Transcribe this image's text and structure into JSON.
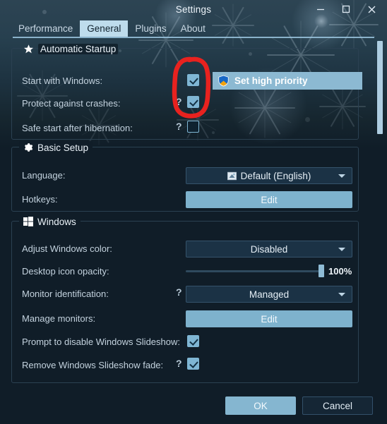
{
  "window": {
    "title": "Settings",
    "controls": [
      {
        "name": "minimize",
        "glyph": "minimize-icon"
      },
      {
        "name": "maximize",
        "glyph": "maximize-icon"
      },
      {
        "name": "close",
        "glyph": "close-icon"
      }
    ]
  },
  "tabs": [
    {
      "label": "Performance",
      "active": false
    },
    {
      "label": "General",
      "active": true
    },
    {
      "label": "Plugins",
      "active": false
    },
    {
      "label": "About",
      "active": false
    }
  ],
  "groups": {
    "automatic_startup": {
      "title": "Automatic Startup",
      "icon": "star-icon",
      "rows": {
        "start_with_windows": {
          "label": "Start with Windows:",
          "checked": true,
          "help": false
        },
        "protect_against_crashes": {
          "label": "Protect against crashes:",
          "checked": true,
          "help": true,
          "help_glyph": "?"
        },
        "safe_start_after_hibernation": {
          "label": "Safe start after hibernation:",
          "checked": false,
          "help": true,
          "help_glyph": "?"
        }
      },
      "set_high_priority": {
        "label": "Set high priority",
        "icon": "uac-shield-icon"
      }
    },
    "basic_setup": {
      "title": "Basic Setup",
      "icon": "gear-icon",
      "rows": {
        "language": {
          "label": "Language:",
          "value": "Default (English)",
          "icon": "flag-icon"
        },
        "hotkeys": {
          "label": "Hotkeys:",
          "button": "Edit"
        }
      }
    },
    "windows": {
      "title": "Windows",
      "icon": "windows-logo-icon",
      "rows": {
        "adjust_windows_color": {
          "label": "Adjust Windows color:",
          "value": "Disabled"
        },
        "desktop_icon_opacity": {
          "label": "Desktop icon opacity:",
          "value": "100%",
          "percent": 100
        },
        "monitor_identification": {
          "label": "Monitor identification:",
          "value": "Managed",
          "help": true,
          "help_glyph": "?"
        },
        "manage_monitors": {
          "label": "Manage monitors:",
          "button": "Edit"
        },
        "prompt_disable_slideshow": {
          "label": "Prompt to disable Windows Slideshow:",
          "checked": true,
          "help": false
        },
        "remove_slideshow_fade": {
          "label": "Remove Windows Slideshow fade:",
          "checked": true,
          "help": true,
          "help_glyph": "?"
        }
      }
    }
  },
  "footer": {
    "ok_label": "OK",
    "cancel_label": "Cancel"
  },
  "annotation": {
    "shape": "hand-drawn-red-circle",
    "color": "#e8221f"
  },
  "colors": {
    "accent": "#7fb6d4",
    "panel": "#101d28",
    "dropdown": "#1b3245",
    "border": "#2b4152",
    "annotation_red": "#e8221f"
  }
}
